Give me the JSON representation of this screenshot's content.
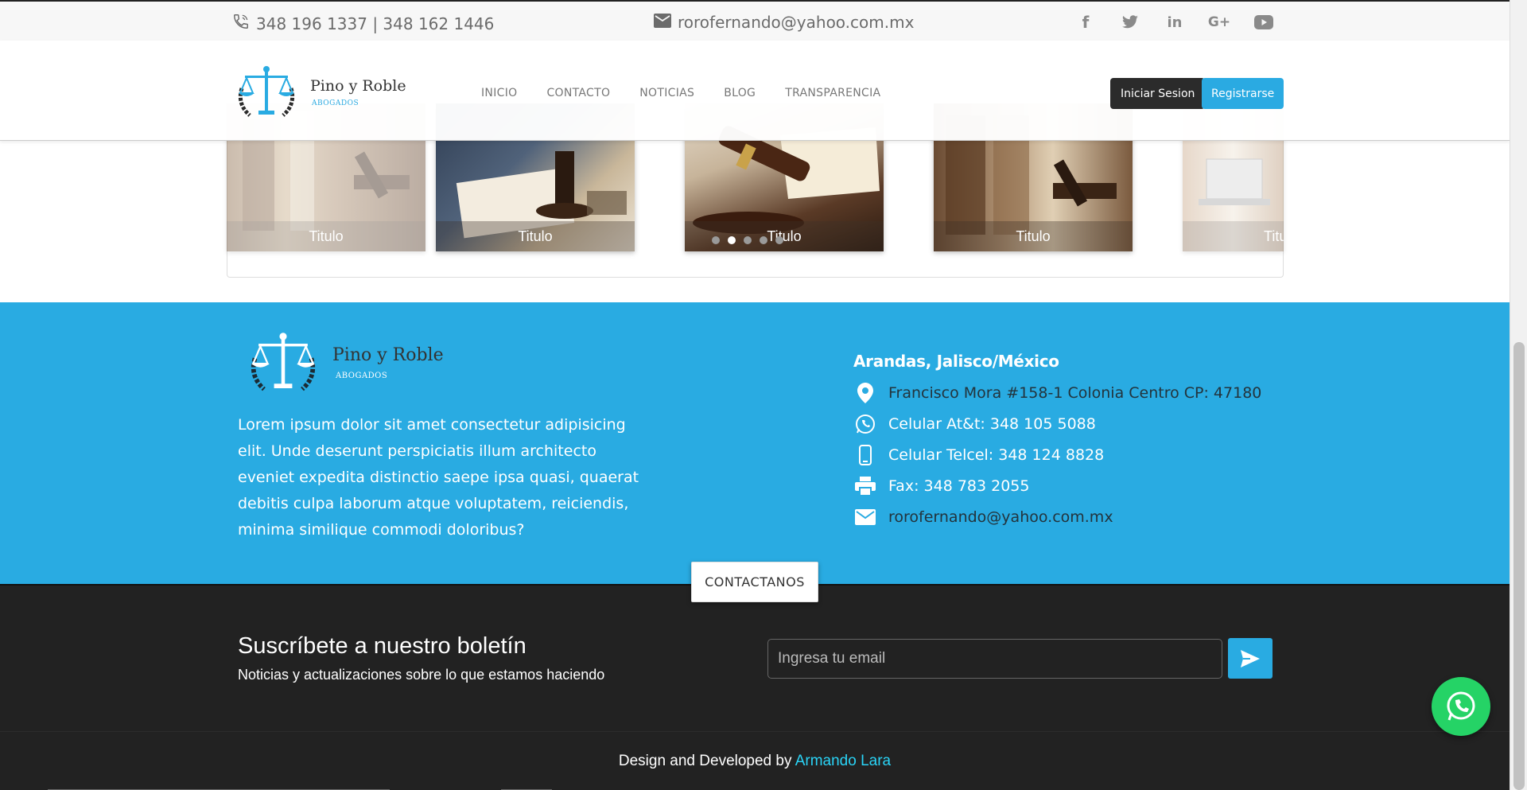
{
  "topbar": {
    "phones": "348 196 1337 | 348 162 1446",
    "email": "rorofernando@yahoo.com.mx",
    "social_icons": [
      "facebook-icon",
      "twitter-icon",
      "linkedin-icon",
      "google-plus-icon",
      "youtube-icon"
    ]
  },
  "header": {
    "brand_name": "Pino y Roble",
    "brand_sub": "ABOGADOS",
    "nav": [
      "INICIO",
      "CONTACTO",
      "NOTICIAS",
      "BLOG",
      "TRANSPARENCIA"
    ],
    "login_label": "Iniciar Sesion",
    "register_label": "Registrarse"
  },
  "carousel": {
    "slides": [
      "Titulo",
      "Titulo",
      "Titulo",
      "Titulo",
      "Titu"
    ],
    "dot_count": 5,
    "active_dot": 2
  },
  "footer": {
    "brand_name": "Pino y Roble",
    "brand_sub": "ABOGADOS",
    "about": "Lorem ipsum dolor sit amet consectetur adipisicing elit. Unde deserunt perspiciatis illum architecto eveniet expedita distinctio saepe ipsa quasi, quaerat debitis culpa laborum atque voluptatem, reiciendis, minima similique commodi doloribus?",
    "city": "Arandas, Jalisco/México",
    "address": "Francisco Mora #158-1 Colonia Centro CP: 47180",
    "cel_att": "Celular At&t: 348 105 5088",
    "cel_telcel": "Celular Telcel: 348 124 8828",
    "fax": "Fax: 348 783 2055",
    "email": "rorofernando@yahoo.com.mx",
    "cta_label": "CONTACTANOS"
  },
  "newsletter": {
    "title": "Suscríbete a nuestro boletín",
    "subtitle": "Noticias y actualizaciones sobre lo que estamos haciendo",
    "placeholder": "Ingresa tu email"
  },
  "credit": {
    "prefix": "Design and Developed by ",
    "author": "Armando Lara"
  },
  "colors": {
    "accent": "#29abe2",
    "dark": "#222222",
    "whatsapp": "#25d366"
  }
}
